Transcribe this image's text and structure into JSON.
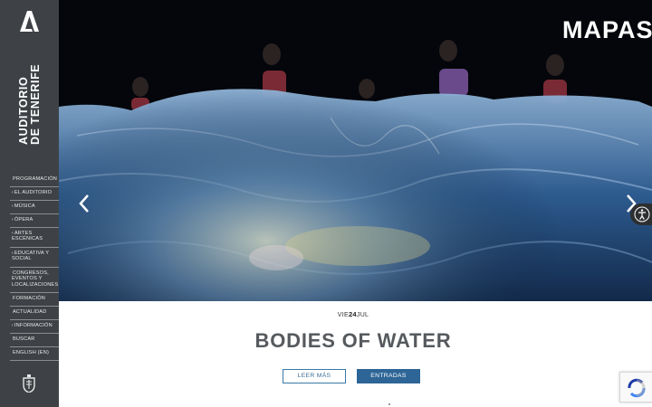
{
  "sidebar": {
    "brand_line1": "AUDITORIO",
    "brand_line2": "DE TENERIFE",
    "nav": [
      {
        "label": "PROGRAMACIÓN",
        "caret": ""
      },
      {
        "label": "EL AUDITORIO",
        "caret": "‹"
      },
      {
        "label": "MÚSICA",
        "caret": "‹"
      },
      {
        "label": "ÓPERA",
        "caret": "‹"
      },
      {
        "label": "ARTES ESCÉNICAS",
        "caret": "‹"
      },
      {
        "label": "EDUCATIVA Y SOCIAL",
        "caret": "‹"
      },
      {
        "label": "CONGRESOS, EVENTOS Y LOCALIZACIONES",
        "caret": ""
      },
      {
        "label": "FORMACIÓN",
        "caret": ""
      },
      {
        "label": "ACTUALIDAD",
        "caret": ""
      },
      {
        "label": "INFORMACIÓN",
        "caret": "‹"
      },
      {
        "label": "BUSCAR",
        "caret": ""
      },
      {
        "label": "ENGLISH (EN)",
        "caret": ""
      }
    ]
  },
  "hero": {
    "festival_logo": "MAPAS",
    "prev_icon": "chevron-left-icon",
    "next_icon": "chevron-right-icon"
  },
  "event": {
    "day": "VIE",
    "date_num": "24",
    "month": "JUL",
    "title": "BODIES OF WATER",
    "more_label": "LEER MÁS",
    "tickets_label": "ENTRADAS"
  },
  "colors": {
    "sidebar_bg": "#3e4246",
    "accent_blue": "#2d6596",
    "title_gray": "#565a5e"
  }
}
